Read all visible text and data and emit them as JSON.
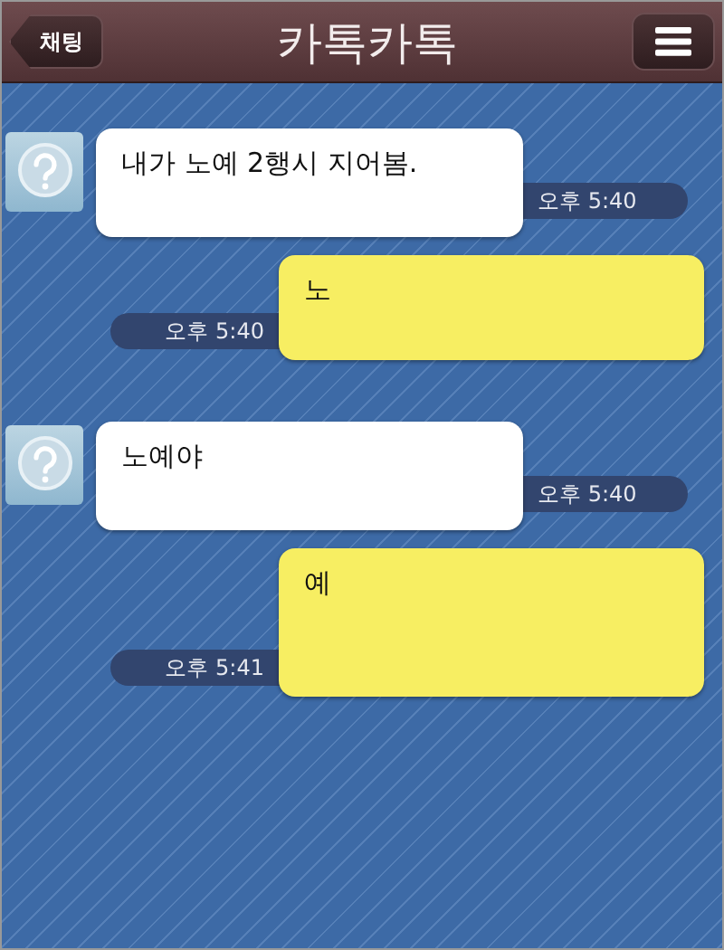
{
  "header": {
    "back_button": "채팅",
    "title": "카톡카톡"
  },
  "messages": [
    {
      "kind": "in",
      "text": "내가 노예 2행시 지어봄.",
      "time": "오후 5:40"
    },
    {
      "kind": "out",
      "text": "노",
      "time": "오후 5:40"
    },
    {
      "kind": "in",
      "text": "노예야",
      "time": "오후 5:40"
    },
    {
      "kind": "out",
      "text": "예",
      "time": "오후 5:41"
    }
  ]
}
